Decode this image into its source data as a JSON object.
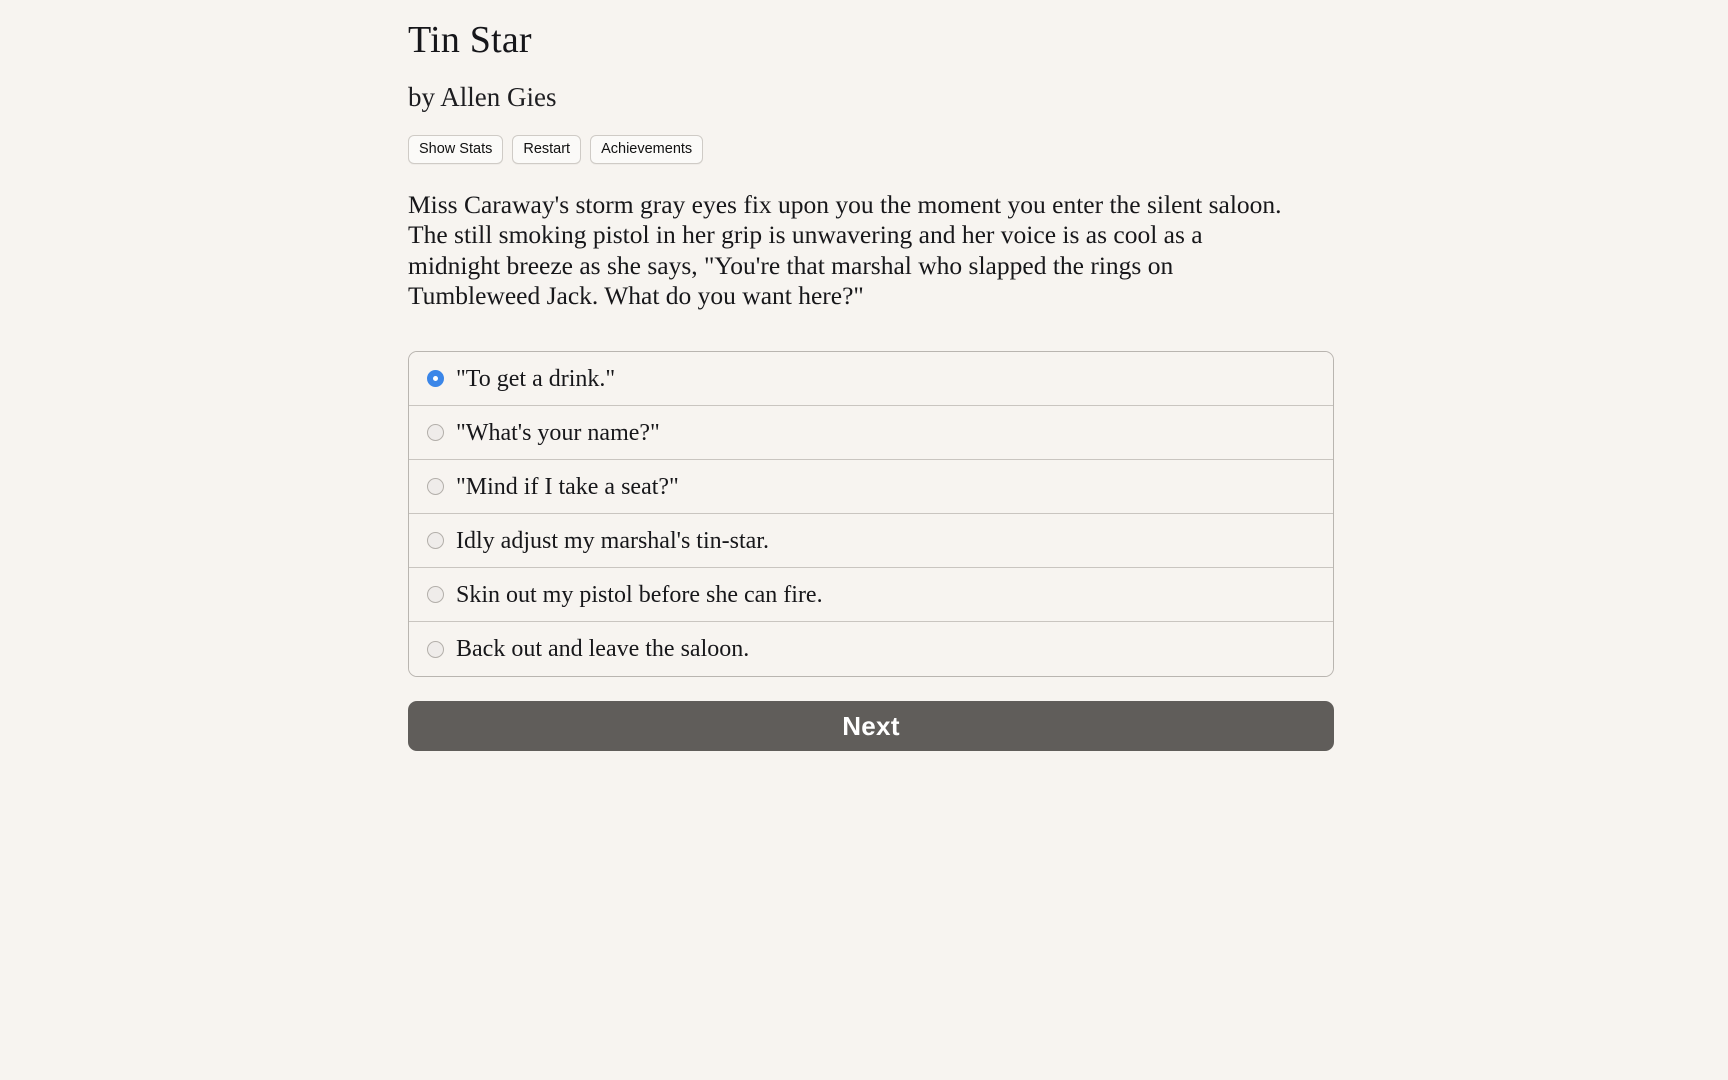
{
  "story": {
    "title": "Tin Star",
    "byline": "by Allen Gies",
    "passage": "Miss Caraway's storm gray eyes fix upon you the moment you enter the silent saloon. The still smoking pistol in her grip is unwavering and her voice is as cool as a midnight breeze as she says, \"You're that marshal who slapped the rings on Tumbleweed Jack. What do you want here?\""
  },
  "toolbar": {
    "show_stats_label": "Show Stats",
    "restart_label": "Restart",
    "achievements_label": "Achievements"
  },
  "choices": {
    "selected_index": 0,
    "options": [
      {
        "label": "\"To get a drink.\"",
        "selected": true
      },
      {
        "label": "\"What's your name?\"",
        "selected": false
      },
      {
        "label": "\"Mind if I take a seat?\"",
        "selected": false
      },
      {
        "label": "Idly adjust my marshal's tin-star.",
        "selected": false
      },
      {
        "label": "Skin out my pistol before she can fire.",
        "selected": false
      },
      {
        "label": "Back out and leave the saloon.",
        "selected": false
      }
    ]
  },
  "actions": {
    "next_label": "Next"
  },
  "colors": {
    "background": "#f7f4f0",
    "text": "#17171a",
    "radio_selected": "#3b86e8",
    "next_button": "#605d5a",
    "border": "#b9b5b0"
  }
}
